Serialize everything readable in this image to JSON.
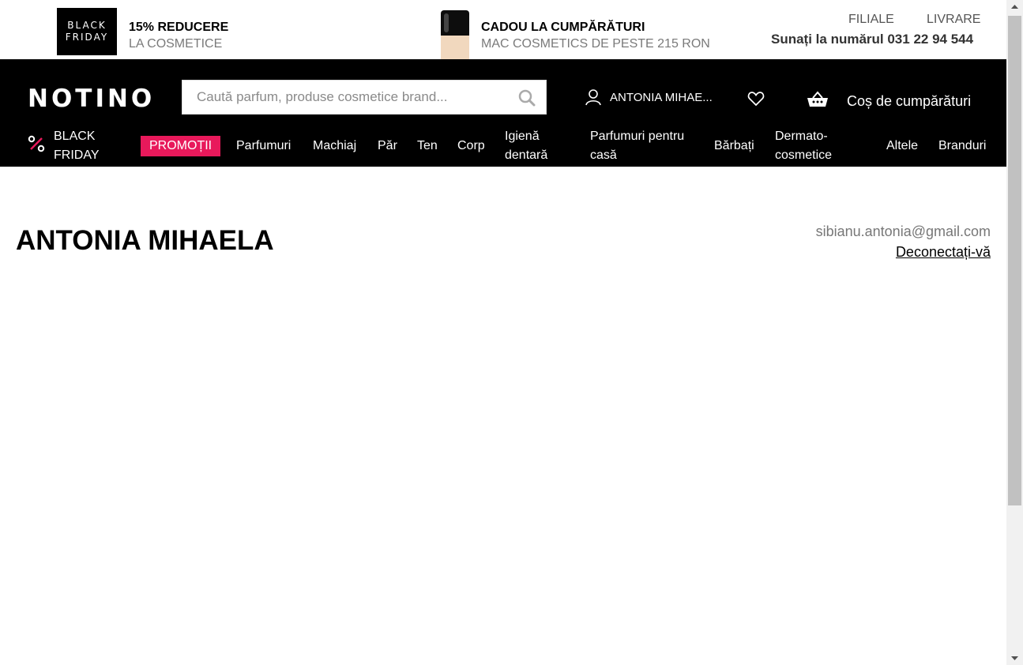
{
  "promo_bar": {
    "badge_line1": "BLACK",
    "badge_line2": "FRIDAY",
    "promo1_title": "15% REDUCERE",
    "promo1_sub": "LA COSMETICE",
    "promo2_title": "CADOU LA CUMPĂRĂTURI",
    "promo2_sub": "MAC COSMETICS DE PESTE 215 RON",
    "link_stores": "FILIALE",
    "link_delivery": "LIVRARE",
    "phone_text": "Sunați la numărul 031 22 94 544"
  },
  "header": {
    "logo": "NOTINO",
    "search_placeholder": "Caută parfum, produse cosmetice brand...",
    "user_name": "ANTONIA MIHAE...",
    "cart_label": "Coș de cumpărături",
    "accent_color": "#e8195b"
  },
  "nav": {
    "black_friday": [
      "BLACK",
      "FRIDAY"
    ],
    "promotii": "PROMOȚII",
    "parfumuri": "Parfumuri",
    "machiaj": "Machiaj",
    "par": "Păr",
    "ten": "Ten",
    "corp": "Corp",
    "igiena": [
      "Igienă",
      "dentară"
    ],
    "parfumuri_casa": [
      "Parfumuri pentru",
      "casă"
    ],
    "barbati": "Bărbați",
    "dermato": [
      "Dermato-",
      "cosmetice"
    ],
    "altele": "Altele",
    "branduri": "Branduri"
  },
  "main": {
    "title": "ANTONIA MIHAELA",
    "email": "sibianu.antonia@gmail.com",
    "logout": "Deconectați-vă"
  }
}
